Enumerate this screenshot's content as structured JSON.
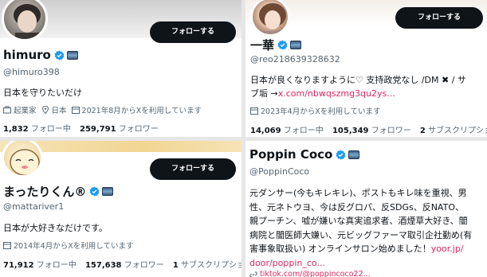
{
  "profiles": [
    {
      "name": "himuro",
      "handle": "@himuro398",
      "follow_label": "フォローする",
      "bio": "日本を守りたいだけ",
      "meta": {
        "job": "起業家",
        "location": "日本",
        "joined": "2021年8月からXを利用しています"
      },
      "stats": {
        "following_count": "1,832",
        "following_label": "フォロー中",
        "followers_count": "259,791",
        "followers_label": "フォロワー"
      }
    },
    {
      "name": "一華",
      "handle": "@reo218639328632",
      "follow_label": "フォローする",
      "bio_line1": "日本が良くなりますように♡ 支持政党なし /DM ✖ / サ",
      "bio_line2_text": "ブ垢 →",
      "bio_line2_link": "x.com/nbwqszmg3qu2ys...",
      "meta": {
        "joined": "2023年4月からXを利用しています"
      },
      "stats": {
        "following_count": "14,069",
        "following_label": "フォロー中",
        "followers_count": "105,349",
        "followers_label": "フォロワー",
        "subs_count": "2",
        "subs_label": "サブスクリプショ"
      }
    },
    {
      "name": "まったりくん®",
      "handle": "@mattariver1",
      "follow_label": "フォローする",
      "bio": "日本が大好きなだけです。",
      "meta": {
        "joined": "2014年4月からXを利用しています"
      },
      "stats": {
        "following_count": "71,912",
        "following_label": "フォロー中",
        "followers_count": "157,638",
        "followers_label": "フォロワー",
        "subs_count": "1",
        "subs_label": "サブスクリプショ"
      }
    },
    {
      "name": "Poppin Coco",
      "handle": "@PoppinCoco",
      "bio_lines": [
        "元ダンサー(今もキレキレ)、ポストもキレ味を重視、男",
        "性、元ネトウヨ、今は反グロパ、反SDGs、反NATO、",
        "親プーチン、嘘が嫌いな真実追求者、酒煙草大好き、闇",
        "病院と闇医師大嫌い、元ビッグファーマ取引企社勤め(有",
        "害事象取扱い) オンラインサロン始めました！"
      ],
      "bio_link_inline": "yoor.jp/",
      "bio_link_line": "door/poppin_co...",
      "meta_link": "tiktok.com/@poppincoco22..."
    }
  ],
  "colors": {
    "follow_button_bg": "#0f1419",
    "text_primary": "#0f1419",
    "text_secondary": "#536471",
    "verified": "#1d9bf0",
    "link": "#e0245e"
  }
}
